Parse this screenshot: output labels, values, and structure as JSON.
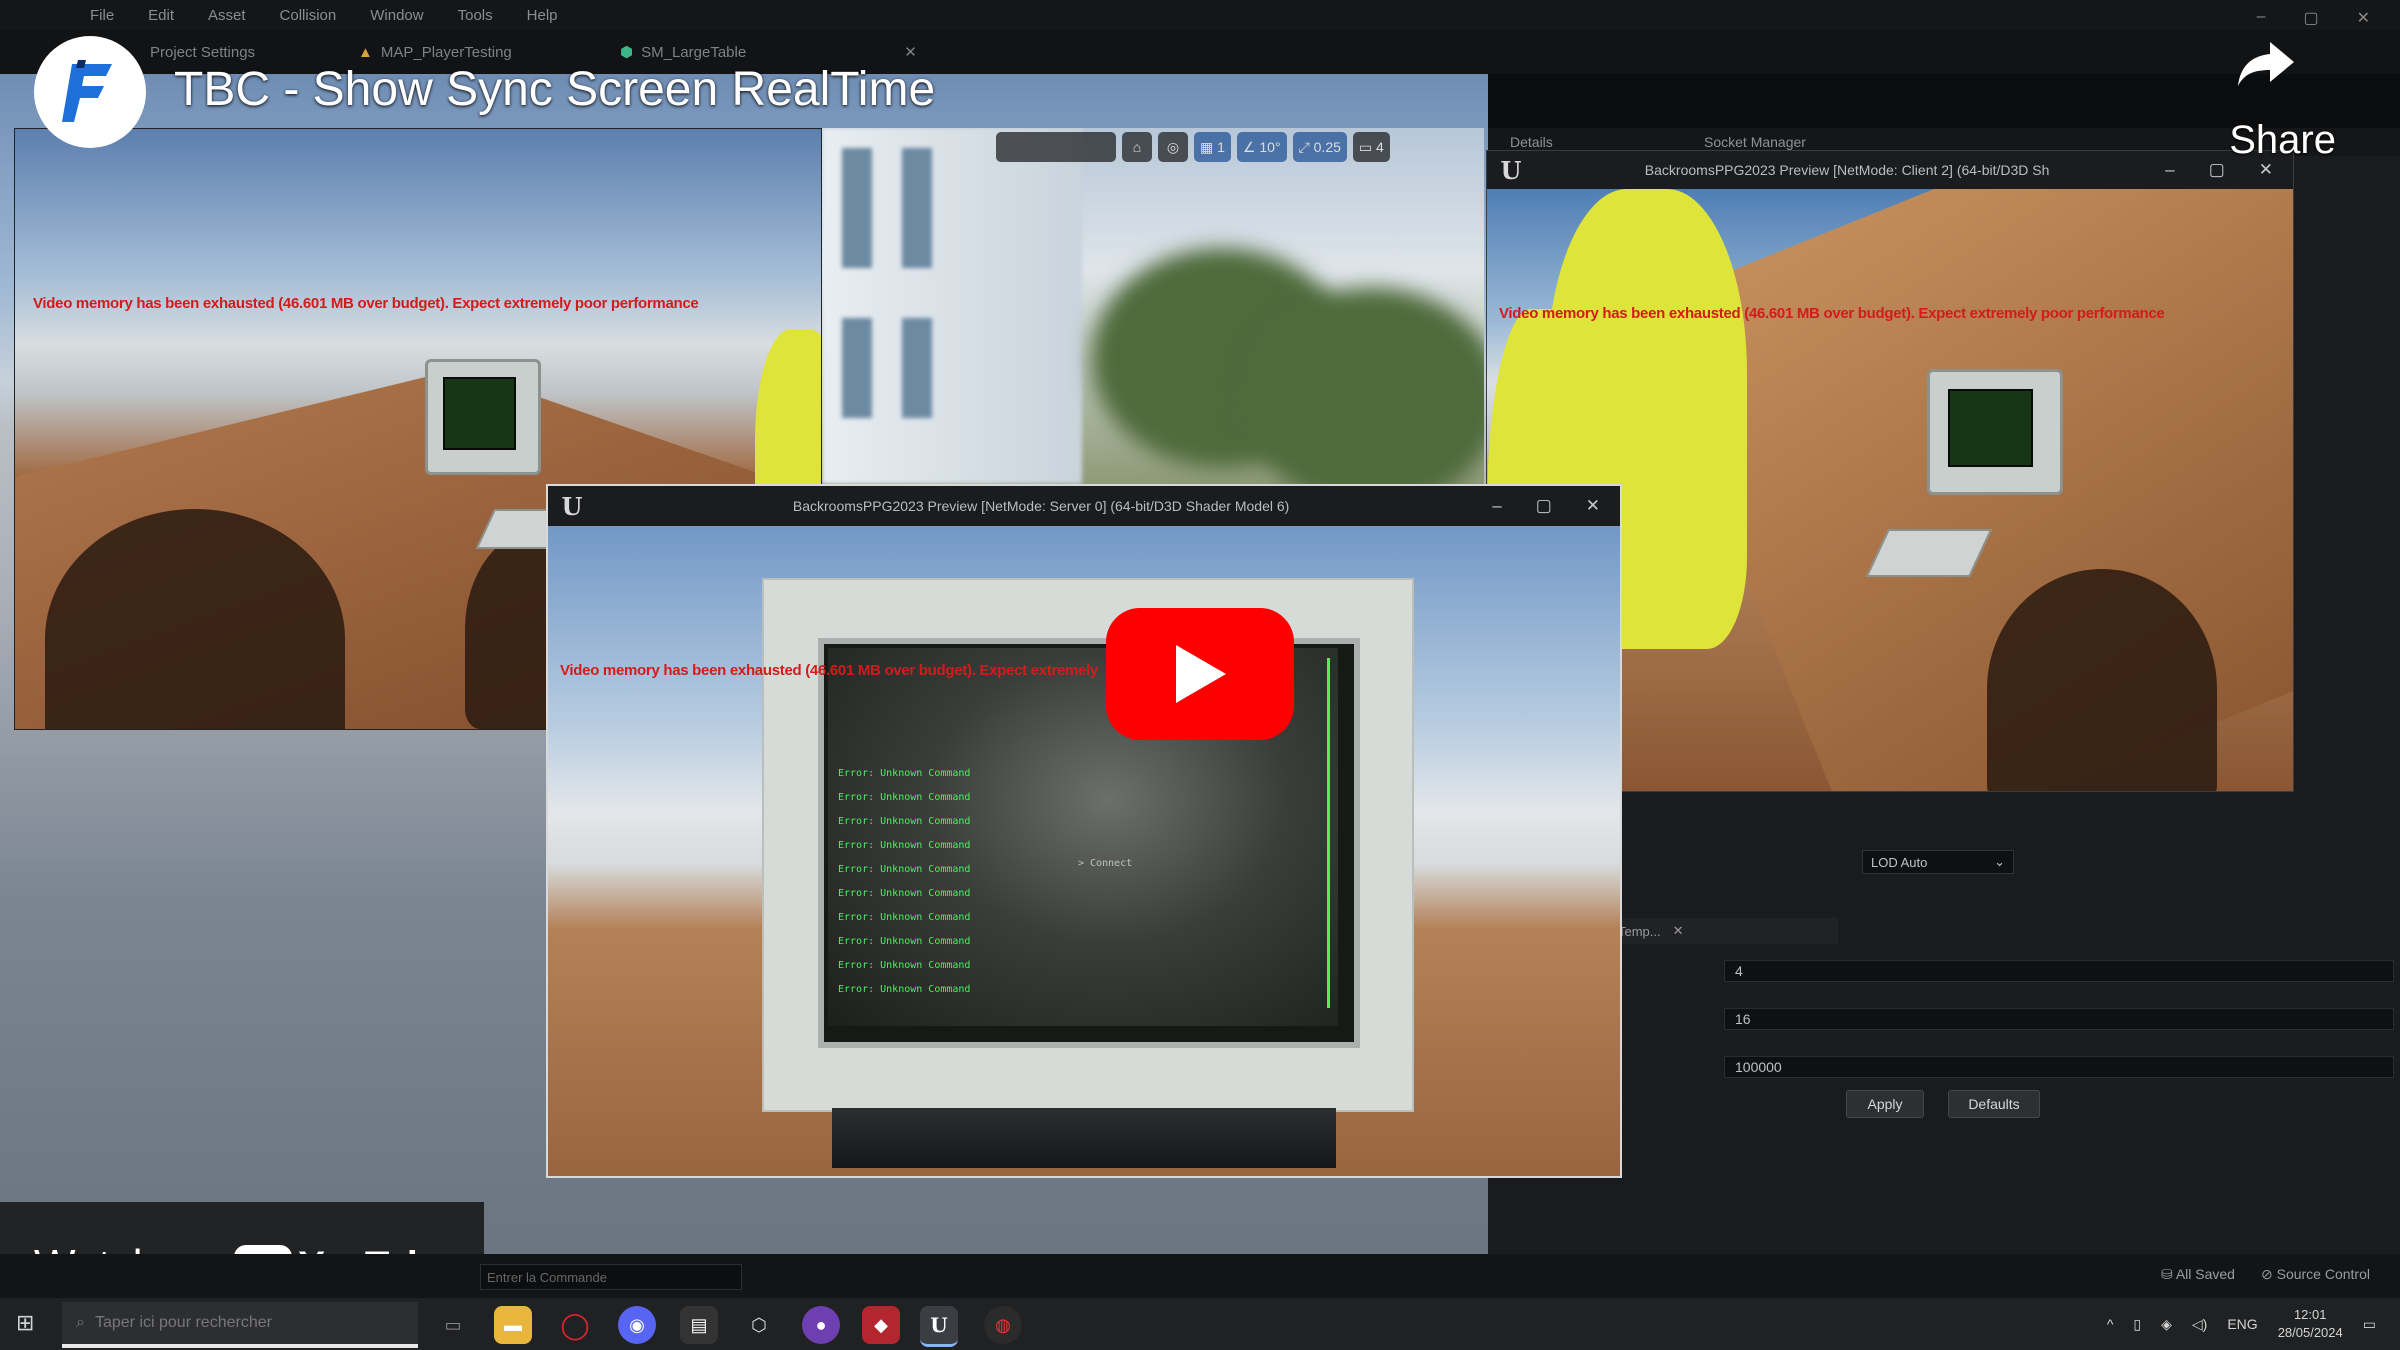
{
  "editor": {
    "menu": [
      "File",
      "Edit",
      "Asset",
      "Collision",
      "Window",
      "Tools",
      "Help"
    ],
    "tabs": [
      "Project Settings",
      "MAP_PlayerTesting",
      "SM_LargeTable"
    ],
    "viewport_toolbar": [
      "1",
      "10°",
      "0.25",
      "4"
    ],
    "details_tabs": [
      "Details",
      "Socket Manager"
    ],
    "lod_select": "LOD Auto",
    "panel_tab2": "Temp...",
    "fields": [
      "4",
      "16",
      "100000"
    ],
    "buttons": {
      "apply": "Apply",
      "defaults": "Defaults"
    },
    "console_placeholder": "Entrer la Commande",
    "status": {
      "saved": "All Saved",
      "source_control": "Source Control"
    }
  },
  "windows": {
    "client2": {
      "title": "BackroomsPPG2023 Preview [NetMode: Client 2]  (64-bit/D3D Sh"
    },
    "server0": {
      "title": "BackroomsPPG2023 Preview [NetMode: Server 0]  (64-bit/D3D Shader Model 6)"
    }
  },
  "warnings": {
    "left": "Video memory has been exhausted (46.601 MB over budget). Expect extremely poor performance",
    "client2": "Video memory has been exhausted (46.601 MB over budget). Expect extremely poor performance",
    "server0": "Video memory has been exhausted (46.601 MB over budget). Expect extremely"
  },
  "terminal": {
    "center_text": "> Connect",
    "lines": [
      "Error: Unknown Command",
      "Error: Unknown Command",
      "Error: Unknown Command",
      "Error: Unknown Command",
      "Error: Unknown Command",
      "Error: Unknown Command",
      "Error: Unknown Command",
      "Error: Unknown Command",
      "Error: Unknown Command",
      "Error: Unknown Command"
    ]
  },
  "youtube": {
    "title": "TBC - Show Sync Screen RealTime",
    "share": "Share",
    "watch_on": "Watch on",
    "logo_word": "YouTube"
  },
  "taskbar": {
    "search_placeholder": "Taper ici pour rechercher",
    "lang": "ENG",
    "time": "12:01",
    "date": "28/05/2024"
  },
  "colors": {
    "warning_red": "#d41b1b",
    "youtube_red": "#ff0000",
    "terminal_green": "#4cf05c"
  },
  "icons": [
    "windows-icon",
    "search-icon",
    "file-explorer-icon",
    "opera-icon",
    "discord-icon",
    "unreal-icon",
    "github-icon",
    "share-arrow-icon",
    "play-icon"
  ]
}
